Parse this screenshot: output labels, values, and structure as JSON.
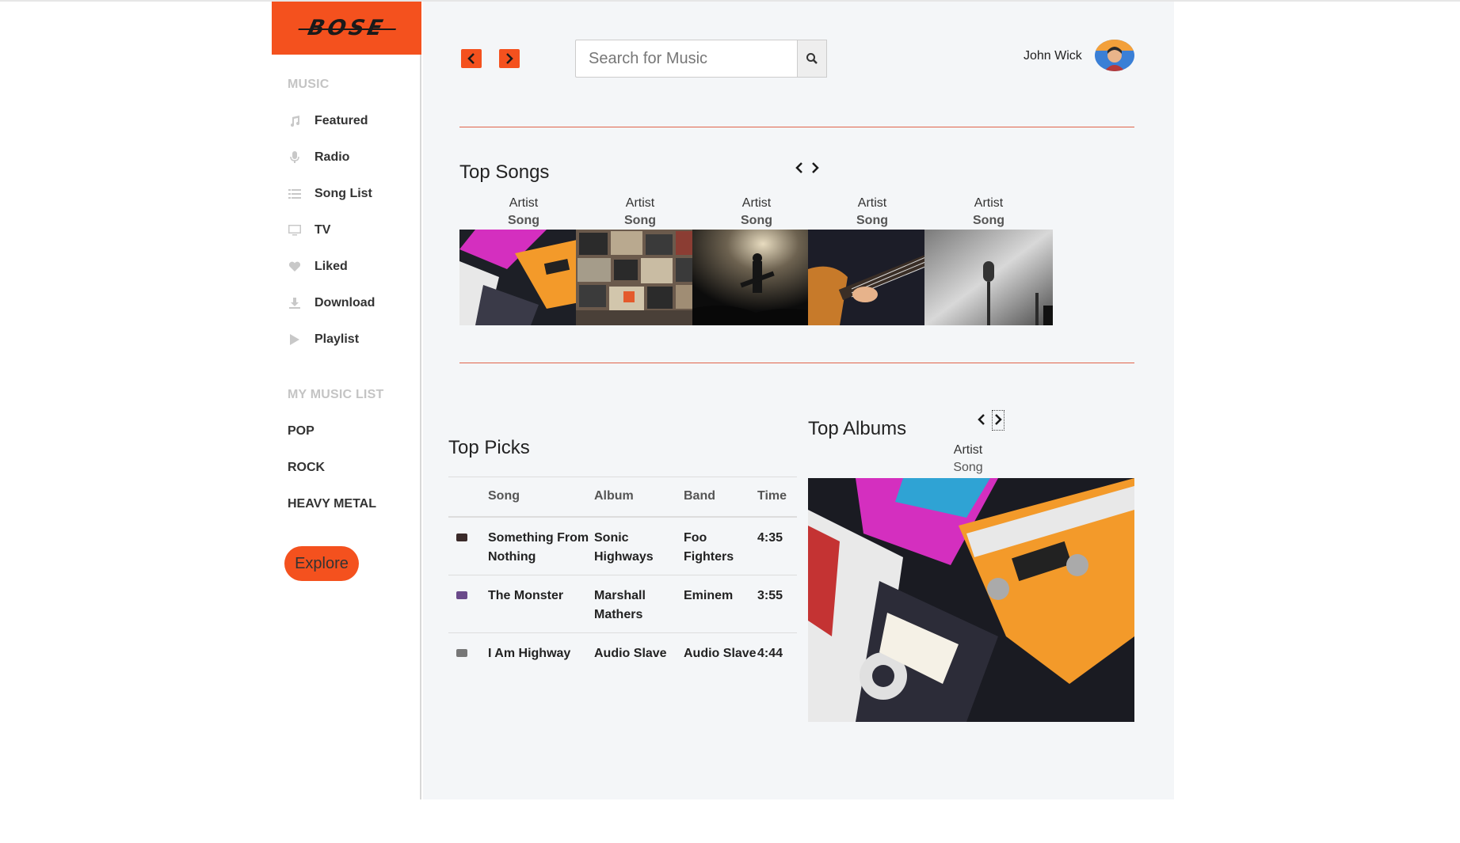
{
  "brand": {
    "logo_text": "BOSE",
    "accent_color": "#f4511e"
  },
  "sidebar": {
    "music_label": "MUSIC",
    "items": [
      {
        "label": "Featured",
        "icon": "music-note-icon"
      },
      {
        "label": "Radio",
        "icon": "microphone-icon"
      },
      {
        "label": "Song List",
        "icon": "list-icon"
      },
      {
        "label": "TV",
        "icon": "tv-icon"
      },
      {
        "label": "Liked",
        "icon": "heart-icon"
      },
      {
        "label": "Download",
        "icon": "download-icon"
      },
      {
        "label": "Playlist",
        "icon": "play-icon"
      }
    ],
    "my_music_label": "MY MUSIC LIST",
    "genres": [
      "POP",
      "ROCK",
      "HEAVY METAL"
    ],
    "explore_label": "Explore"
  },
  "header": {
    "search_placeholder": "Search for Music",
    "user_name": "John Wick"
  },
  "top_songs": {
    "title": "Top Songs",
    "cards": [
      {
        "artist": "Artist",
        "song": "Song"
      },
      {
        "artist": "Artist",
        "song": "Song"
      },
      {
        "artist": "Artist",
        "song": "Song"
      },
      {
        "artist": "Artist",
        "song": "Song"
      },
      {
        "artist": "Artist",
        "song": "Song"
      }
    ]
  },
  "top_picks": {
    "title": "Top Picks",
    "columns": [
      "Song",
      "Album",
      "Band",
      "Time"
    ],
    "rows": [
      {
        "song": "Something From Nothing",
        "album": "Sonic Highways",
        "band": "Foo Fighters",
        "time": "4:35"
      },
      {
        "song": "The Monster",
        "album": "Marshall Mathers",
        "band": "Eminem",
        "time": "3:55"
      },
      {
        "song": "I Am Highway",
        "album": "Audio Slave",
        "band": "Audio Slave",
        "time": "4:44"
      }
    ]
  },
  "top_albums": {
    "title": "Top Albums",
    "artist": "Artist",
    "song": "Song"
  }
}
